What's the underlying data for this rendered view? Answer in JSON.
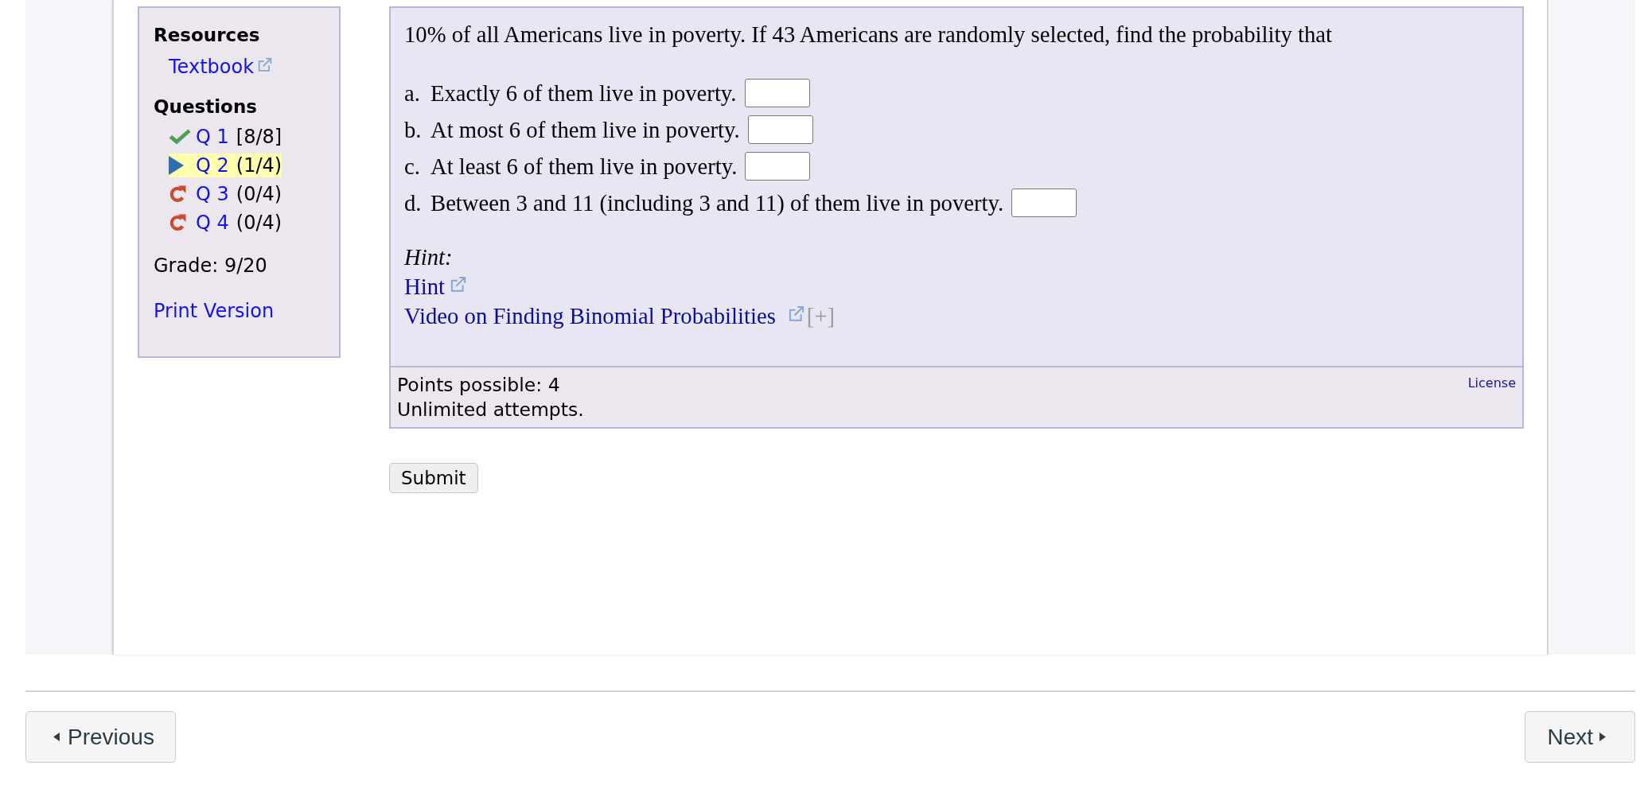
{
  "sidebar": {
    "resources_heading": "Resources",
    "resources": [
      {
        "label": "Textbook",
        "external": true
      }
    ],
    "questions_heading": "Questions",
    "questions": [
      {
        "label": "Q 1",
        "score": "[8/8]",
        "kind": "correct",
        "selected": false
      },
      {
        "label": "Q 2",
        "score": "(1/4)",
        "kind": "current",
        "selected": true
      },
      {
        "label": "Q 3",
        "score": "(0/4)",
        "kind": "retry",
        "selected": false
      },
      {
        "label": "Q 4",
        "score": "(0/4)",
        "kind": "retry",
        "selected": false
      }
    ],
    "grade": "Grade: 9/20",
    "print_link": "Print Version"
  },
  "question": {
    "prompt": "10% of all Americans live in poverty. If 43 Americans are randomly selected, find the probability that",
    "parts": [
      {
        "label": "a.",
        "text": "Exactly 6 of them live in poverty."
      },
      {
        "label": "b.",
        "text": "At most 6 of them live in poverty."
      },
      {
        "label": "c.",
        "text": "At least 6 of them live in poverty."
      },
      {
        "label": "d.",
        "text": "Between 3 and 11 (including 3 and 11) of them live in poverty."
      }
    ],
    "hint_heading": "Hint:",
    "hint_links": [
      {
        "label": "Hint",
        "external": true
      },
      {
        "label": "Video on Finding Binomial Probabilities",
        "external": true,
        "expand": "[+]"
      }
    ]
  },
  "footer": {
    "points": "Points possible: 4",
    "attempts": "Unlimited attempts.",
    "license": "License"
  },
  "submit": "Submit",
  "nav": {
    "previous": "Previous",
    "next": "Next"
  }
}
